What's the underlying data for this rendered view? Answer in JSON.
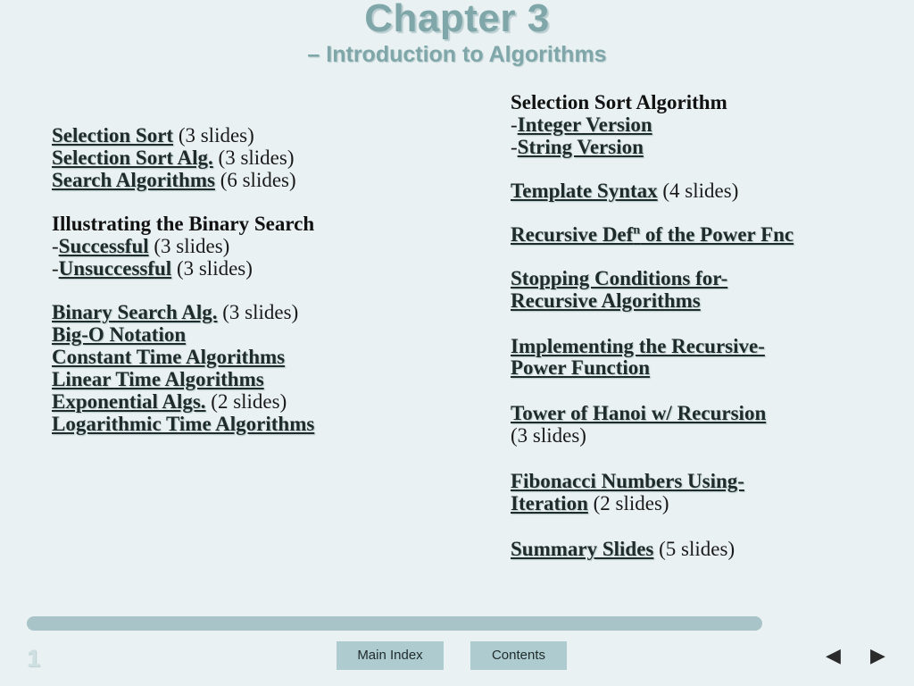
{
  "title": {
    "chapter": "Chapter 3",
    "subtitle": "– Introduction to Algorithms"
  },
  "left_column": [
    {
      "link": "Selection Sort",
      "suffix": " (3 slides)"
    },
    {
      "link": "Selection Sort Alg.",
      "suffix": " (3 slides)"
    },
    {
      "link": "Search Algorithms",
      "suffix": " (6 slides)"
    },
    {
      "heading": "Illustrating the Binary Search"
    },
    {
      "dash": "-",
      "link": "Successful",
      "suffix": " (3 slides)"
    },
    {
      "dash": "-",
      "link": "Unsuccessful",
      "suffix": " (3 slides)"
    },
    {
      "link": "Binary Search Alg.",
      "suffix": " (3 slides)"
    },
    {
      "link": "Big-O Notation",
      "suffix": ""
    },
    {
      "link": "Constant Time Algorithms",
      "suffix": ""
    },
    {
      "link": "Linear Time Algorithms",
      "suffix": ""
    },
    {
      "link": "Exponential Algs.",
      "suffix": " (2 slides)"
    },
    {
      "link": "Logarithmic Time Algorithms",
      "suffix": ""
    }
  ],
  "right_column": [
    {
      "heading": "Selection Sort Algorithm"
    },
    {
      "dash": "-",
      "link": "Integer Version",
      "suffix": ""
    },
    {
      "dash": "-",
      "link": "String Version",
      "suffix": ""
    },
    {
      "link": "Template Syntax",
      "suffix": " (4 slides)"
    },
    {
      "link": "Recursive Def",
      "sup": "n",
      "link2": " of the Power Fnc",
      "suffix": ""
    },
    {
      "link": "Stopping Conditions for-",
      "link_line2": "Recursive Algorithms",
      "suffix": ""
    },
    {
      "link": "Implementing the Recursive-",
      "link_line2": "Power Function",
      "suffix": ""
    },
    {
      "link": "Tower of Hanoi w/ Recursion",
      "suffix_line2": "(3 slides)"
    },
    {
      "link": "Fibonacci Numbers Using-",
      "link_line2": " Iteration",
      "suffix": " (2 slides)"
    },
    {
      "link": "Summary Slides",
      "suffix": " (5 slides)"
    }
  ],
  "footer": {
    "page_number": "1",
    "main_index_label": "Main Index",
    "contents_label": "Contents",
    "prev_arrow": "◀",
    "next_arrow": "▶"
  }
}
